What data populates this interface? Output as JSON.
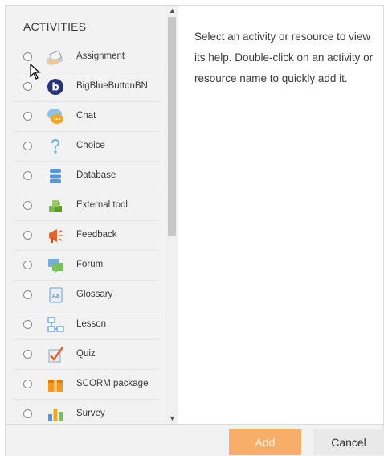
{
  "sidebar": {
    "heading": "ACTIVITIES",
    "items": [
      {
        "label": "Assignment",
        "icon": "assignment-icon"
      },
      {
        "label": "BigBlueButtonBN",
        "icon": "bigbluebutton-icon"
      },
      {
        "label": "Chat",
        "icon": "chat-icon"
      },
      {
        "label": "Choice",
        "icon": "choice-icon"
      },
      {
        "label": "Database",
        "icon": "database-icon"
      },
      {
        "label": "External tool",
        "icon": "external-tool-icon"
      },
      {
        "label": "Feedback",
        "icon": "feedback-icon"
      },
      {
        "label": "Forum",
        "icon": "forum-icon"
      },
      {
        "label": "Glossary",
        "icon": "glossary-icon"
      },
      {
        "label": "Lesson",
        "icon": "lesson-icon"
      },
      {
        "label": "Quiz",
        "icon": "quiz-icon"
      },
      {
        "label": "SCORM package",
        "icon": "scorm-icon"
      },
      {
        "label": "Survey",
        "icon": "survey-icon"
      }
    ]
  },
  "help": {
    "text": "Select an activity or resource to view its help. Double-click on an activity or resource name to quickly add it."
  },
  "footer": {
    "add_label": "Add",
    "cancel_label": "Cancel"
  },
  "colors": {
    "add_button": "#f6ae68",
    "cancel_button": "#e9e9e9",
    "pane_background": "#f2f2f2"
  }
}
